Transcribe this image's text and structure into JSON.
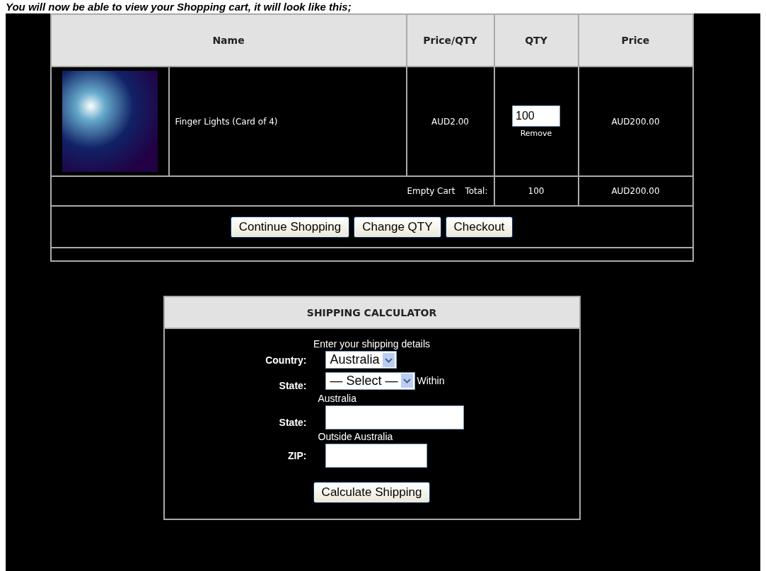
{
  "intro": "You will now be able to view your Shopping cart, it will look like this;",
  "cart": {
    "columns": [
      "Name",
      "Price/QTY",
      "QTY",
      "Price"
    ],
    "rows": [
      {
        "name": "Finger Lights (Card of 4)",
        "unit_price": "AUD2.00",
        "qty": "100",
        "remove": "Remove",
        "price": "AUD200.00"
      }
    ],
    "empty_cart": "Empty Cart",
    "total_label": "Total:",
    "total_qty": "100",
    "total_price": "AUD200.00",
    "buttons": [
      "Continue Shopping",
      "Change QTY",
      "Checkout"
    ]
  },
  "shipping": {
    "title": "SHIPPING CALCULATOR",
    "subtitle": "Enter your shipping details",
    "fields": [
      {
        "kind": "select",
        "label": "Country:",
        "value": "Australia"
      },
      {
        "kind": "select",
        "label": "State:",
        "value": "— Select —",
        "note_inline": "Within",
        "note": "Australia"
      },
      {
        "kind": "text",
        "label": "State:",
        "note": "Outside Australia"
      },
      {
        "kind": "text",
        "label": "ZIP:"
      }
    ],
    "button": "Calculate Shipping"
  }
}
